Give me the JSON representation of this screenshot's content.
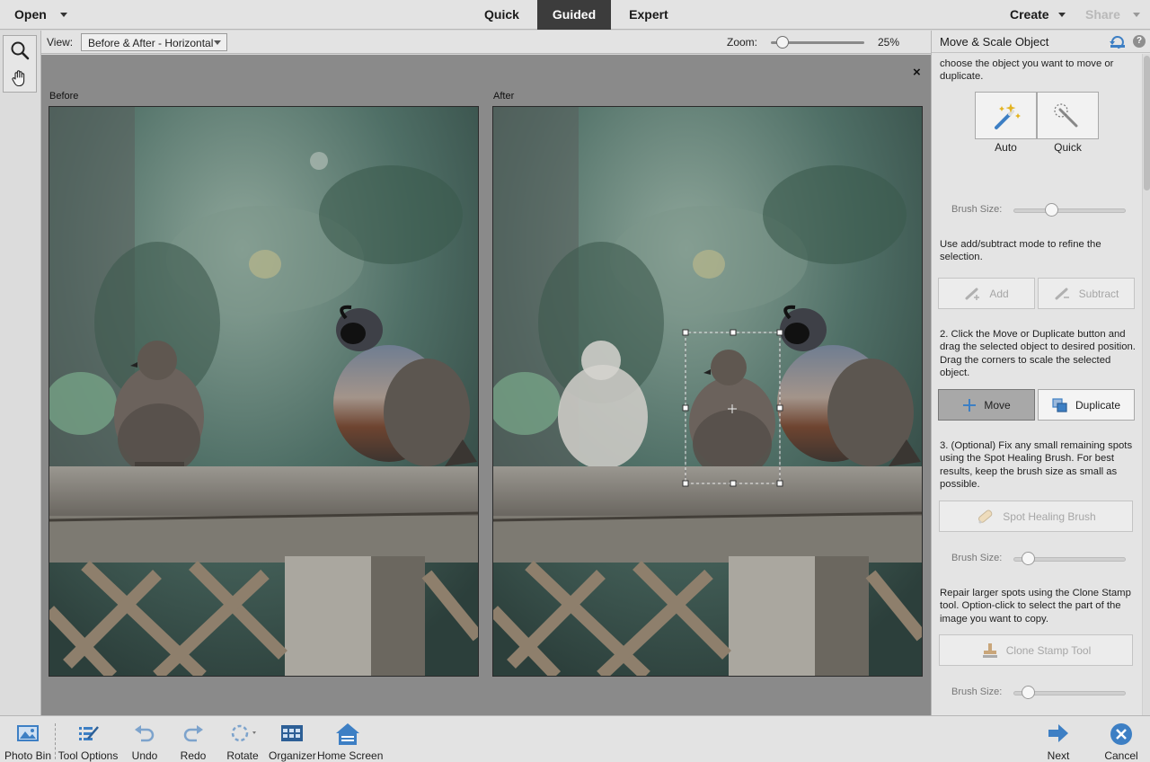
{
  "topbar": {
    "open_label": "Open",
    "modes": [
      "Quick",
      "Guided",
      "Expert"
    ],
    "active_mode": "Guided",
    "create_label": "Create",
    "share_label": "Share"
  },
  "tools": [
    {
      "name": "zoom-tool",
      "icon": "magnifier-icon"
    },
    {
      "name": "hand-tool",
      "icon": "hand-icon"
    }
  ],
  "viewbar": {
    "view_label": "View:",
    "view_value": "Before & After - Horizontal",
    "zoom_label": "Zoom:",
    "zoom_value": "25%",
    "zoom_level": 0.1
  },
  "canvas": {
    "close_glyph": "×",
    "before_label": "Before",
    "after_label": "After"
  },
  "panel": {
    "title": "Move & Scale Object",
    "intro": "choose the object you want to move or duplicate.",
    "auto_label": "Auto",
    "quick_label": "Quick",
    "brush_size_label": "Brush Size:",
    "refine_text": "Use add/subtract mode to refine the selection.",
    "add_label": "Add",
    "subtract_label": "Subtract",
    "step2_text": "2. Click the Move or Duplicate button and drag the selected object to desired position. Drag the corners to scale the selected object.",
    "move_label": "Move",
    "duplicate_label": "Duplicate",
    "step3_text": "3. (Optional) Fix any small remaining spots using the Spot Healing Brush. For best results, keep the brush size as small as possible.",
    "spot_healing_label": "Spot Healing Brush",
    "clone_text": "Repair larger spots using the Clone Stamp tool. Option-click to select the part of the image you want to copy.",
    "clone_stamp_label": "Clone Stamp Tool",
    "brush_levels": [
      0.3,
      0.08,
      0.08
    ]
  },
  "bottombar": {
    "photo_bin": "Photo Bin",
    "tool_options": "Tool Options",
    "undo": "Undo",
    "redo": "Redo",
    "rotate": "Rotate",
    "organizer": "Organizer",
    "home_screen": "Home Screen",
    "next": "Next",
    "cancel": "Cancel"
  },
  "colors": {
    "accent_blue": "#3d7fc4",
    "active_mode_bg": "#3c3c3c",
    "canvas_bg": "#8a8a8a"
  }
}
